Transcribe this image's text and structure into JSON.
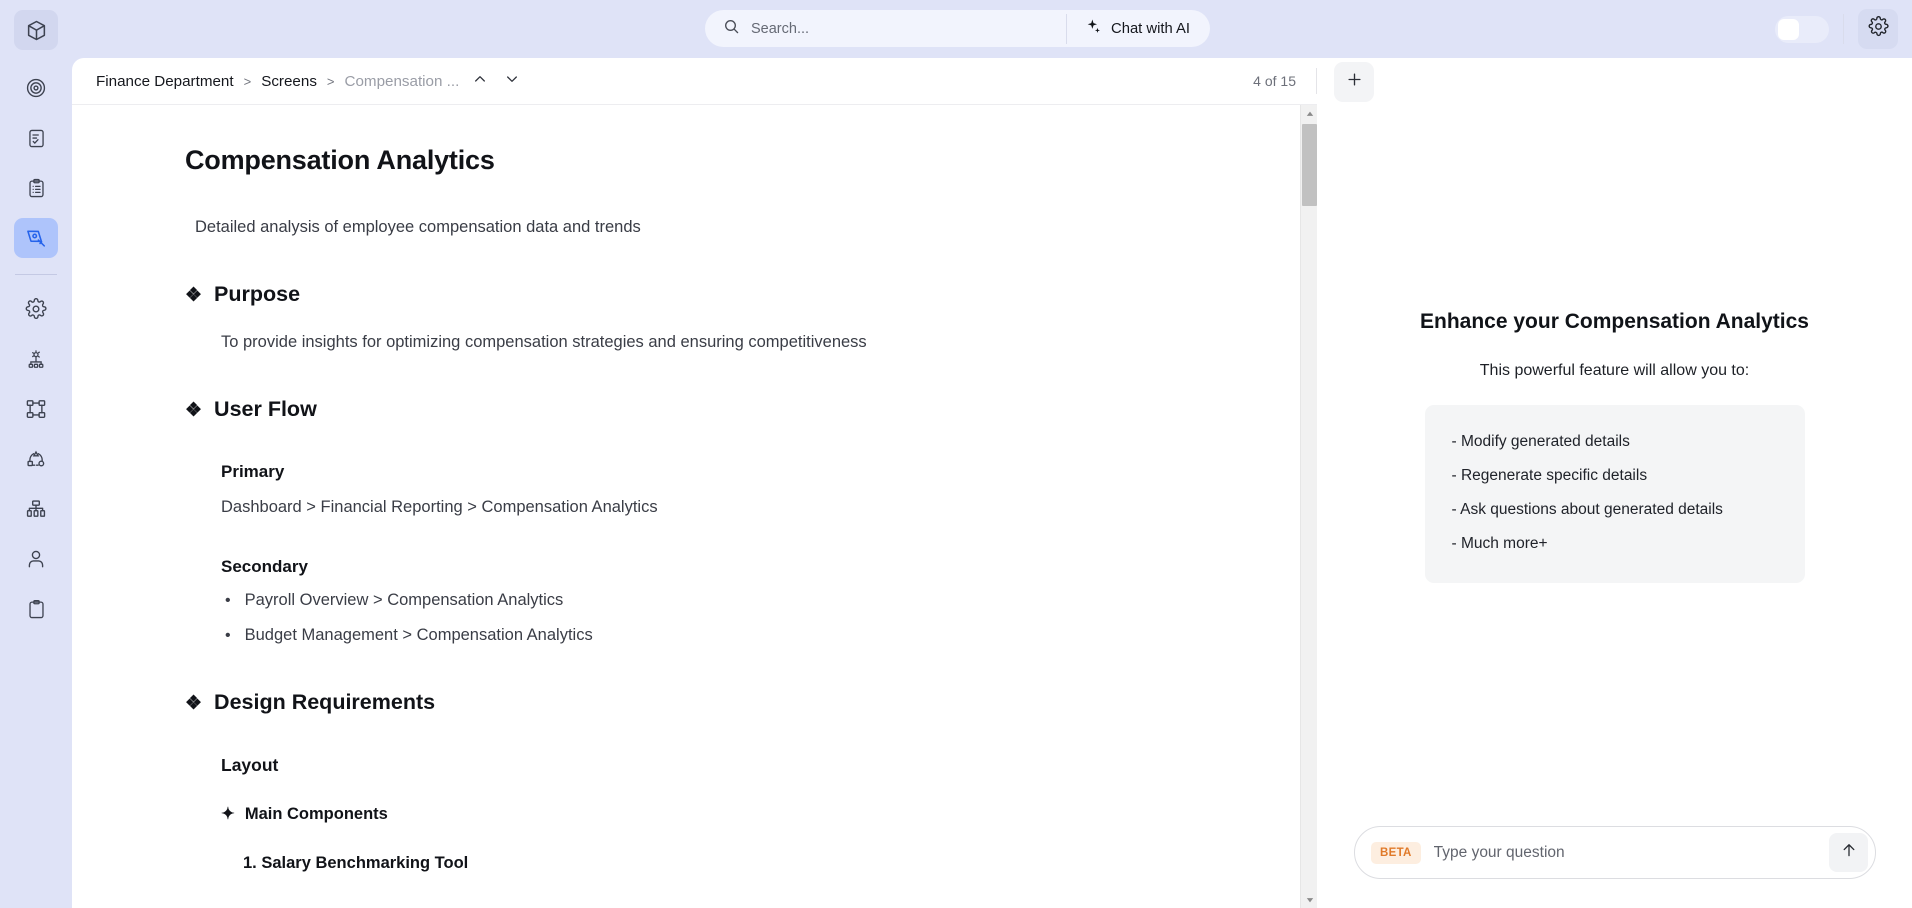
{
  "app": {
    "accent": "#2563eb",
    "rail_bg": "#dfe3f7",
    "beta_color": "#e07a2a"
  },
  "rail": {
    "items": [
      {
        "icon": "cube-icon",
        "name": "logo-cube",
        "active": false,
        "logo": true
      },
      {
        "icon": "target-icon",
        "name": "sidebar-item-target",
        "active": false
      },
      {
        "icon": "document-check-icon",
        "name": "sidebar-item-documents",
        "active": false
      },
      {
        "icon": "clipboard-list-icon",
        "name": "sidebar-item-tasks",
        "active": false
      },
      {
        "icon": "pen-tool-icon",
        "name": "sidebar-item-design",
        "active": true
      },
      {
        "icon": "gear-icon",
        "name": "sidebar-item-settings",
        "active": false
      },
      {
        "icon": "workflow-gear-icon",
        "name": "sidebar-item-automation",
        "active": false
      },
      {
        "icon": "nodes-icon",
        "name": "sidebar-item-flows",
        "active": false
      },
      {
        "icon": "shapes-arc-icon",
        "name": "sidebar-item-journey",
        "active": false
      },
      {
        "icon": "hierarchy-icon",
        "name": "sidebar-item-sitemap",
        "active": false
      },
      {
        "icon": "user-icon",
        "name": "sidebar-item-profile",
        "active": false
      },
      {
        "icon": "clipboard-icon",
        "name": "sidebar-item-reports",
        "active": false
      }
    ]
  },
  "topbar": {
    "search": {
      "placeholder": "Search...",
      "value": ""
    },
    "chat_with_ai_label": "Chat with AI"
  },
  "document": {
    "breadcrumb": {
      "items": [
        "Finance Department",
        "Screens",
        "Compensation ..."
      ],
      "separator": ">"
    },
    "page_counter": "4 of 15",
    "title": "Compensation Analytics",
    "subtitle": "Detailed analysis of employee compensation data and trends",
    "sections": {
      "purpose": {
        "bullet": "❖",
        "heading": "Purpose",
        "body": "To provide insights for optimizing compensation strategies and ensuring competitiveness"
      },
      "user_flow": {
        "bullet": "❖",
        "heading": "User Flow",
        "primary_label": "Primary",
        "primary_path": "Dashboard > Financial Reporting > Compensation Analytics",
        "secondary_label": "Secondary",
        "secondary_items": [
          "Payroll Overview > Compensation Analytics",
          "Budget Management > Compensation Analytics"
        ]
      },
      "design_requirements": {
        "bullet": "❖",
        "heading": "Design Requirements",
        "layout_label": "Layout",
        "main_components_bullet": "✦",
        "main_components_label": "Main Components",
        "first_component": "1. Salary Benchmarking Tool"
      }
    }
  },
  "ai_panel": {
    "new_chat_label": "+",
    "heading": "Enhance your Compensation Analytics",
    "subheading": "This powerful feature will allow you to:",
    "features": [
      "- Modify generated details",
      "- Regenerate specific details",
      "- Ask questions about generated details",
      "- Much more+"
    ],
    "composer": {
      "badge": "BETA",
      "placeholder": "Type your question",
      "value": ""
    }
  }
}
